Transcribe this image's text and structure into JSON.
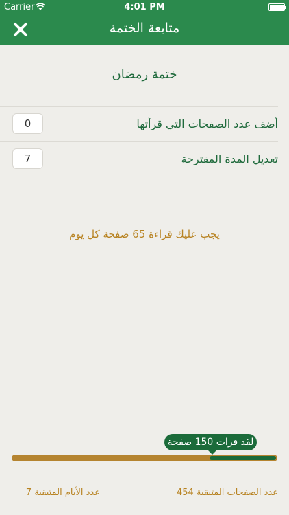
{
  "status_bar": {
    "carrier": "Carrier",
    "time": "4:01 PM"
  },
  "header": {
    "title": "متابعة الختمة"
  },
  "khatma": {
    "name": "ختمة رمضان"
  },
  "rows": [
    {
      "label": "أضف عدد الصفحات التي قرأتها",
      "value": "0"
    },
    {
      "label": "تعديل المدة المقترحة",
      "value": "7"
    }
  ],
  "advice": "يجب عليك قراءة 65 صفحة كل يوم",
  "progress": {
    "tooltip": "لقد قرات 150 صفحة",
    "fraction": 0.25
  },
  "stats": {
    "pages_label": "عدد الصفحات المتبقية",
    "pages_value": "454",
    "days_label": "عدد الأيام المتبقية",
    "days_value": "7"
  },
  "colors": {
    "primary": "#2b8a4d",
    "accent": "#b88322",
    "dark_green": "#1b6b3a"
  }
}
